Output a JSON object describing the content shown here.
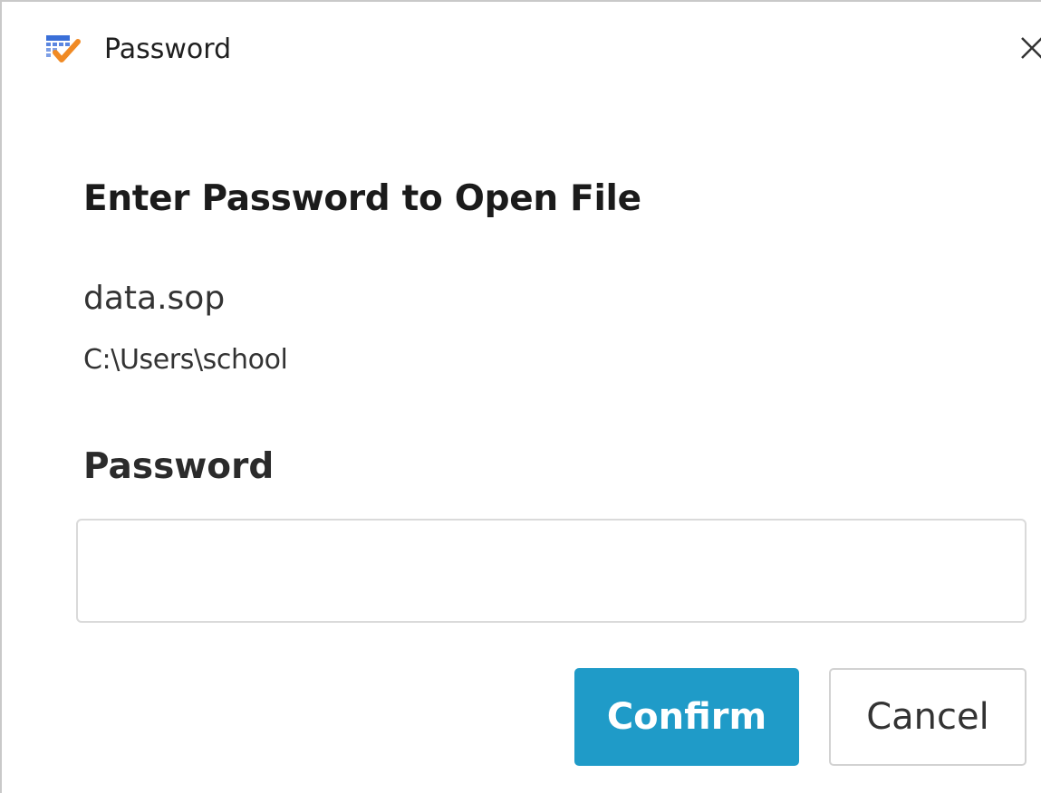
{
  "window": {
    "title": "Password",
    "app_icon": "calendar-check-icon",
    "close_icon": "close-icon"
  },
  "dialog": {
    "heading": "Enter Password to Open File",
    "file_name": "data.sop",
    "file_path": "C:\\Users\\school",
    "password_label": "Password",
    "password_value": "",
    "confirm_label": "Confirm",
    "cancel_label": "Cancel"
  },
  "colors": {
    "accent": "#1f9bc8",
    "icon_orange": "#f08a24",
    "icon_blue": "#3a6fd8"
  }
}
